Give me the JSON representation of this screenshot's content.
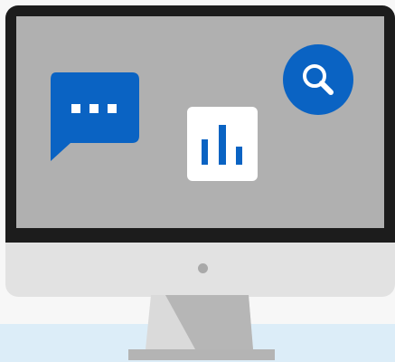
{
  "colors": {
    "page_background": "#f7f7f7",
    "floor": "#dcedf8",
    "bezel": "#1c1c1c",
    "screen": "#b0b0b0",
    "chin": "#e2e2e2",
    "power_dot": "#a9a9a9",
    "stand_light": "#dadada",
    "stand_dark": "#b6b6b6",
    "stand_base": "#b4b4b4",
    "accent_blue": "#0a63c3",
    "white": "#ffffff"
  },
  "icons": {
    "chat": "chat-bubble-ellipsis-icon",
    "chart": "bar-chart-icon",
    "search": "magnifier-icon"
  }
}
